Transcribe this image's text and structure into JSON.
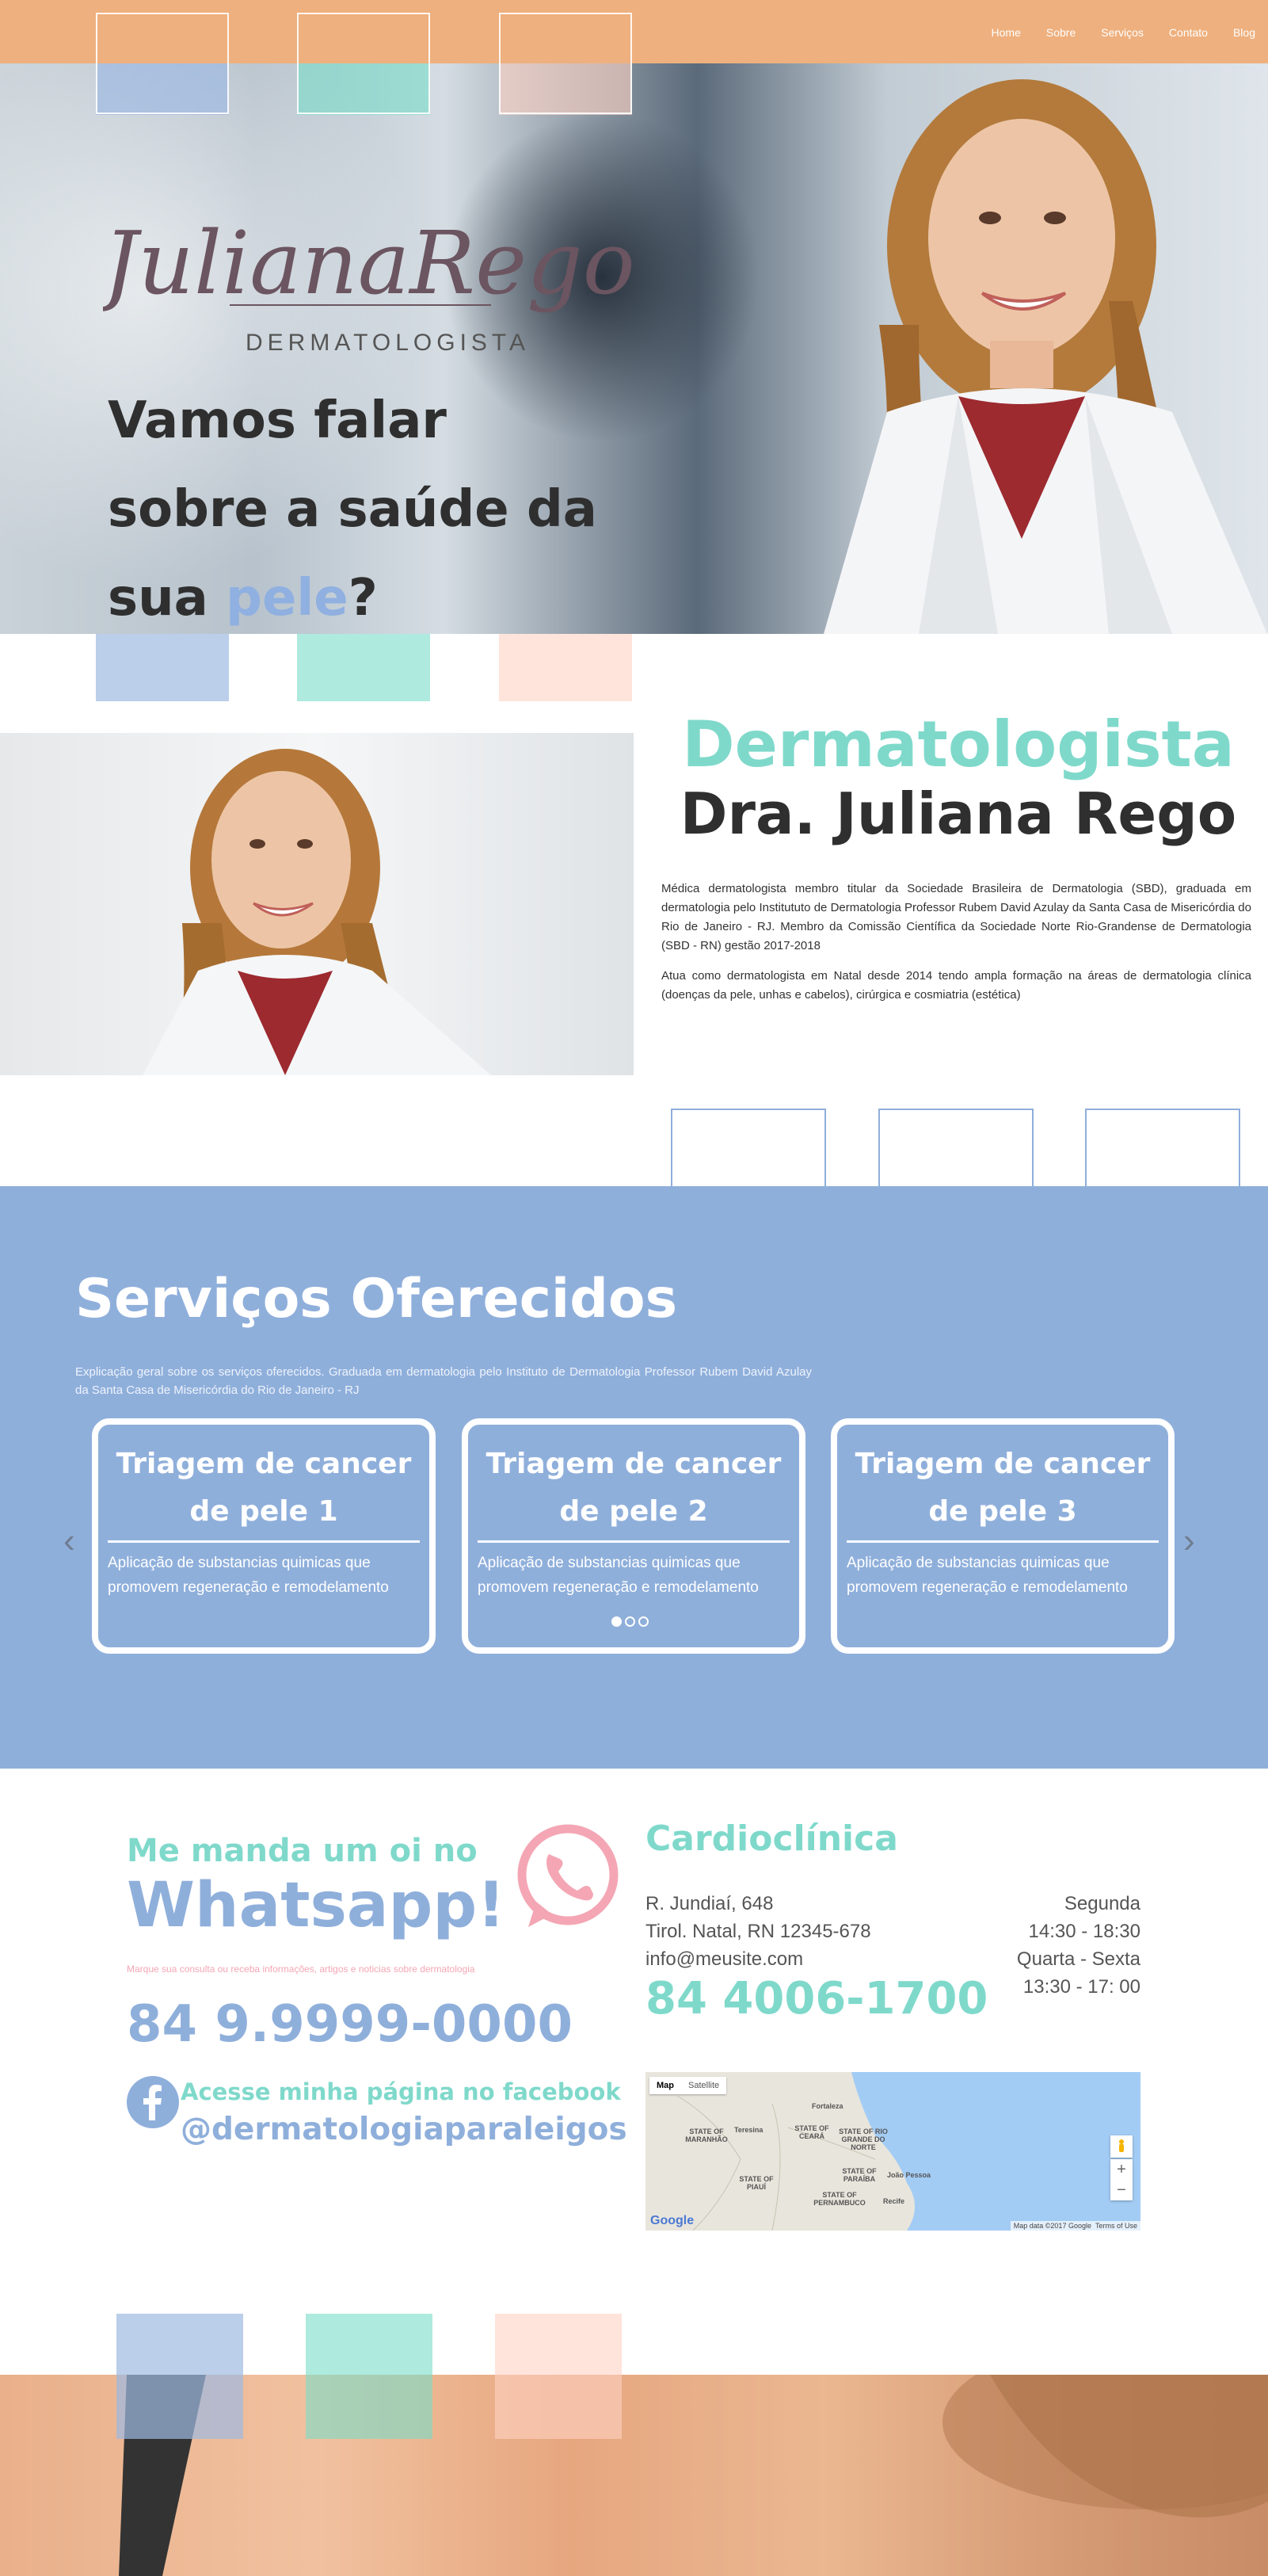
{
  "nav": {
    "items": [
      "Home",
      "Sobre",
      "Serviços",
      "Contato",
      "Blog"
    ]
  },
  "hero": {
    "logo_script": "JulianaRego",
    "logo_subtitle": "DERMATOLOGISTA",
    "headline_line1": "Vamos falar",
    "headline_line2": "sobre a saúde da",
    "headline_line3_pre": "sua ",
    "headline_highlight": "pele",
    "headline_line3_post": "?"
  },
  "about": {
    "title": "Dermatologista",
    "name": "Dra. Juliana Rego",
    "paragraph1": "Médica dermatologista membro titular da Sociedade Brasileira de Dermatologia (SBD), graduada em dermatologia pelo Institututo de Dermatologia Professor Rubem David Azulay da Santa Casa de Misericórdia do Rio de Janeiro - RJ. Membro da Comissão Científica da Sociedade Norte Rio-Grandense de Dermatologia (SBD - RN) gestão 2017-2018",
    "paragraph2": "Atua como dermatologista em Natal desde 2014 tendo ampla formação na áreas de dermatologia clínica (doenças da pele, unhas e cabelos), cirúrgica e cosmiatria (estética)"
  },
  "services": {
    "title": "Serviços Oferecidos",
    "description": "Explicação geral sobre os serviços oferecidos. Graduada em dermatologia pelo Instituto de Dermatologia Professor Rubem David Azulay da Santa Casa de Misericórdia do Rio de Janeiro - RJ",
    "cards": [
      {
        "title_line1": "Triagem de cancer",
        "title_line2": "de pele 1",
        "text": "Aplicação de substancias quimicas que promovem regeneração e remodelamento"
      },
      {
        "title_line1": "Triagem de cancer",
        "title_line2": "de pele 2",
        "text": "Aplicação de substancias quimicas que promovem regeneração e remodelamento"
      },
      {
        "title_line1": "Triagem de cancer",
        "title_line2": "de pele 3",
        "text": "Aplicação de substancias quimicas que promovem regeneração e remodelamento"
      }
    ],
    "active_slide": 1,
    "slide_count": 3
  },
  "contact": {
    "whatsapp_line1": "Me manda um oi no",
    "whatsapp_line2": "Whatsapp!",
    "whatsapp_small": "Marque sua consulta ou receba informações, artigos e noticias sobre dermatologia",
    "whatsapp_phone": "84 9.9999-0000",
    "facebook_line1": "Acesse minha página no facebook",
    "facebook_handle": "@dermatologiaparaleigos",
    "clinic_name": "Cardioclínica",
    "address_line1": "R. Jundiaí, 648",
    "address_line2": "Tirol. Natal, RN 12345-678",
    "email": "info@meusite.com",
    "hours_day1": "Segunda",
    "hours_time1": "14:30 - 18:30",
    "hours_day2": "Quarta - Sexta",
    "hours_time2": "13:30 - 17: 00",
    "clinic_phone": "84 4006-1700"
  },
  "map": {
    "btn_map": "Map",
    "btn_satellite": "Satellite",
    "zoom_in": "+",
    "zoom_out": "−",
    "google": "Google",
    "footer_data": "Map data ©2017 Google",
    "footer_terms": "Terms of Use",
    "labels": [
      "Fortaleza",
      "Teresina",
      "STATE OF MARANHÃO",
      "STATE OF CEARÁ",
      "STATE OF RIO GRANDE DO NORTE",
      "STATE OF PIAUÍ",
      "STATE OF PARAÍBA",
      "João Pessoa",
      "STATE OF PERNAMBUCO",
      "Recife"
    ]
  },
  "colors": {
    "nav": "#eeb07e",
    "teal": "#7fd9cb",
    "blue": "#8fafdb",
    "pink": "#f4a6b4"
  }
}
